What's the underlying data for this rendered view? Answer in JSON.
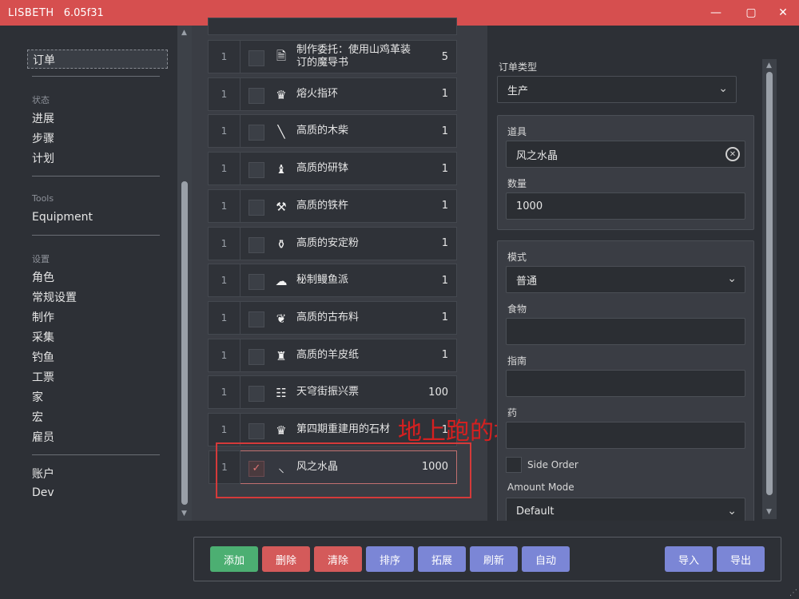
{
  "window": {
    "app_name": "LISBETH",
    "version": "6.05f31",
    "minimize": "—",
    "maximize": "▢",
    "close": "✕"
  },
  "sidebar": {
    "selected": "订单",
    "sections": [
      {
        "heading": "状态",
        "items": [
          "进展",
          "步骤",
          "计划"
        ]
      },
      {
        "heading": "Tools",
        "items": [
          "Equipment"
        ]
      },
      {
        "heading": "设置",
        "items": [
          "角色",
          "常规设置",
          "制作",
          "采集",
          "钓鱼",
          "工票",
          "家",
          "宏",
          "雇员"
        ]
      },
      {
        "heading": "",
        "items": [
          "账户",
          "Dev"
        ]
      }
    ]
  },
  "orders": [
    {
      "num": "1",
      "name": "制作委托：使用山鸡革装订的魔导书",
      "qty": "5",
      "icon": "book-icon",
      "checked": false
    },
    {
      "num": "1",
      "name": "熔火指环",
      "qty": "1",
      "icon": "crown-icon",
      "checked": false
    },
    {
      "num": "1",
      "name": "高质的木柴",
      "qty": "1",
      "icon": "log-icon",
      "checked": false
    },
    {
      "num": "1",
      "name": "高质的研钵",
      "qty": "1",
      "icon": "mortar-icon",
      "checked": false
    },
    {
      "num": "1",
      "name": "高质的铁杵",
      "qty": "1",
      "icon": "anvil-icon",
      "checked": false
    },
    {
      "num": "1",
      "name": "高质的安定粉",
      "qty": "1",
      "icon": "powder-icon",
      "checked": false
    },
    {
      "num": "1",
      "name": "秘制鳗鱼派",
      "qty": "1",
      "icon": "pie-icon",
      "checked": false
    },
    {
      "num": "1",
      "name": "高质的古布料",
      "qty": "1",
      "icon": "leaf-icon",
      "checked": false
    },
    {
      "num": "1",
      "name": "高质的羊皮纸",
      "qty": "1",
      "icon": "scroll-icon",
      "checked": false
    },
    {
      "num": "1",
      "name": "天穹街振兴票",
      "qty": "100",
      "icon": "clipboard-icon",
      "checked": false
    },
    {
      "num": "1",
      "name": "第四期重建用的石材",
      "qty": "1",
      "icon": "crown-icon",
      "checked": false
    },
    {
      "num": "1",
      "name": "风之水晶",
      "qty": "1000",
      "icon": "pickaxe-icon",
      "checked": true
    }
  ],
  "checkmark": "✓",
  "annotation": "地上跑的地图物品可挖",
  "form": {
    "order_type_label": "订单类型",
    "order_type_value": "生产",
    "item_label": "道具",
    "item_value": "风之水晶",
    "quantity_label": "数量",
    "quantity_value": "1000",
    "mode_label": "模式",
    "mode_value": "普通",
    "food_label": "食物",
    "food_value": "",
    "guide_label": "指南",
    "guide_value": "",
    "medicine_label": "药",
    "medicine_value": "",
    "side_order_label": "Side Order",
    "amount_mode_label": "Amount Mode",
    "amount_mode_value": "Default"
  },
  "buttons": {
    "add": "添加",
    "delete": "删除",
    "clear": "清除",
    "sort": "排序",
    "expand": "拓展",
    "refresh": "刷新",
    "auto": "自动",
    "import": "导入",
    "export": "导出"
  },
  "colors": {
    "titlebar": "#d64f4f",
    "green": "#4caf72",
    "red": "#d45a5a",
    "blue": "#7b86d6"
  }
}
